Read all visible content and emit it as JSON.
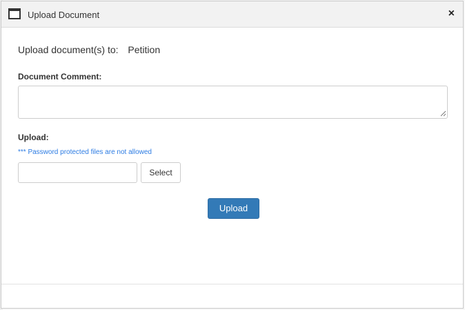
{
  "dialog": {
    "title": "Upload Document",
    "close_symbol": "×",
    "icon": "window-icon"
  },
  "destination": {
    "label": "Upload document(s) to:",
    "value": "Petition"
  },
  "comment": {
    "label": "Document Comment:",
    "value": ""
  },
  "upload": {
    "label": "Upload:",
    "notice": "*** Password protected files are not allowed",
    "file_value": "",
    "select_label": "Select",
    "submit_label": "Upload"
  },
  "colors": {
    "primary": "#337ab7",
    "notice": "#2b7be3",
    "titlebar": "#f2f2f2"
  }
}
